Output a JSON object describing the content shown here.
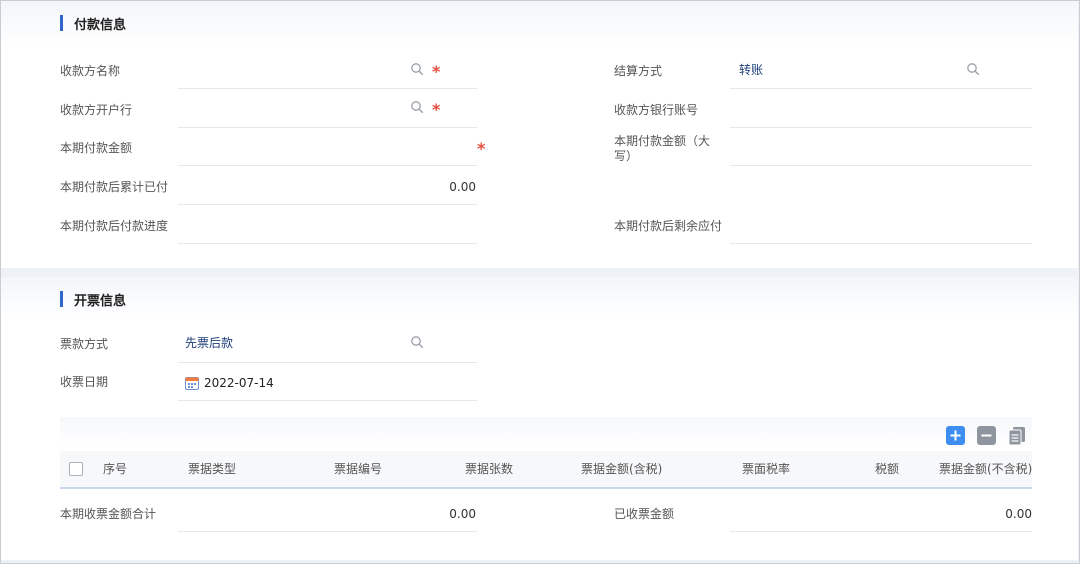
{
  "payment": {
    "title": "付款信息",
    "payee_name": {
      "label": "收款方名称",
      "value": ""
    },
    "settlement_method": {
      "label": "结算方式",
      "value": "转账"
    },
    "payee_bank": {
      "label": "收款方开户行",
      "value": ""
    },
    "payee_account": {
      "label": "收款方银行账号",
      "value": ""
    },
    "amount": {
      "label": "本期付款金额",
      "value": ""
    },
    "amount_caps": {
      "label_line1": "本期付款金额（大",
      "label_line2": "写）",
      "value": ""
    },
    "cumulative_paid": {
      "label": "本期付款后累计已付",
      "value": "0.00"
    },
    "progress": {
      "label": "本期付款后付款进度",
      "value": ""
    },
    "remaining": {
      "label": "本期付款后剩余应付",
      "value": ""
    },
    "required_mark": "*"
  },
  "invoice": {
    "title": "开票信息",
    "invoice_method": {
      "label": "票款方式",
      "value": "先票后款"
    },
    "receipt_date": {
      "label": "收票日期",
      "value": "2022-07-14"
    },
    "table": {
      "columns": [
        "序号",
        "票据类型",
        "票据编号",
        "票据张数",
        "票据金额(含税)",
        "票面税率",
        "税额",
        "票据金额(不含税)"
      ],
      "rows": []
    },
    "total": {
      "label": "本期收票金额合计",
      "value": "0.00"
    },
    "received": {
      "label": "已收票金额",
      "value": "0.00"
    }
  },
  "colors": {
    "accent": "#2f66c9",
    "required": "#e84c3d",
    "add_button": "#3d8ef0",
    "remove_button": "#8f959e"
  },
  "icons": [
    "search-icon",
    "calendar-icon",
    "add-row-icon",
    "remove-row-icon",
    "copy-row-icon",
    "checkbox"
  ]
}
